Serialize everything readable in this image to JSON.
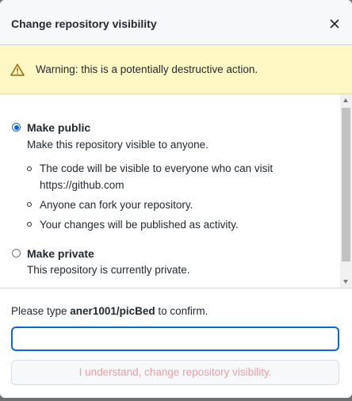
{
  "dialog": {
    "title": "Change repository visibility",
    "close_icon": "close-icon"
  },
  "warning": {
    "icon": "alert-triangle-icon",
    "text": "Warning: this is a potentially destructive action."
  },
  "options": {
    "public": {
      "label": "Make public",
      "description": "Make this repository visible to anyone.",
      "checked": true,
      "bullets": [
        "The code will be visible to everyone who can visit https://github.com",
        "Anyone can fork your repository.",
        "Your changes will be published as activity."
      ]
    },
    "private": {
      "label": "Make private",
      "description": "This repository is currently private.",
      "checked": false
    }
  },
  "confirm": {
    "prefix": "Please type ",
    "repo_name": "aner1001/picBed",
    "suffix": " to confirm.",
    "input_value": "",
    "button_label": "I understand, change repository visibility."
  },
  "colors": {
    "accent": "#0969da",
    "warning_bg": "#fff8c5",
    "danger_text_disabled": "#f09ea5"
  }
}
